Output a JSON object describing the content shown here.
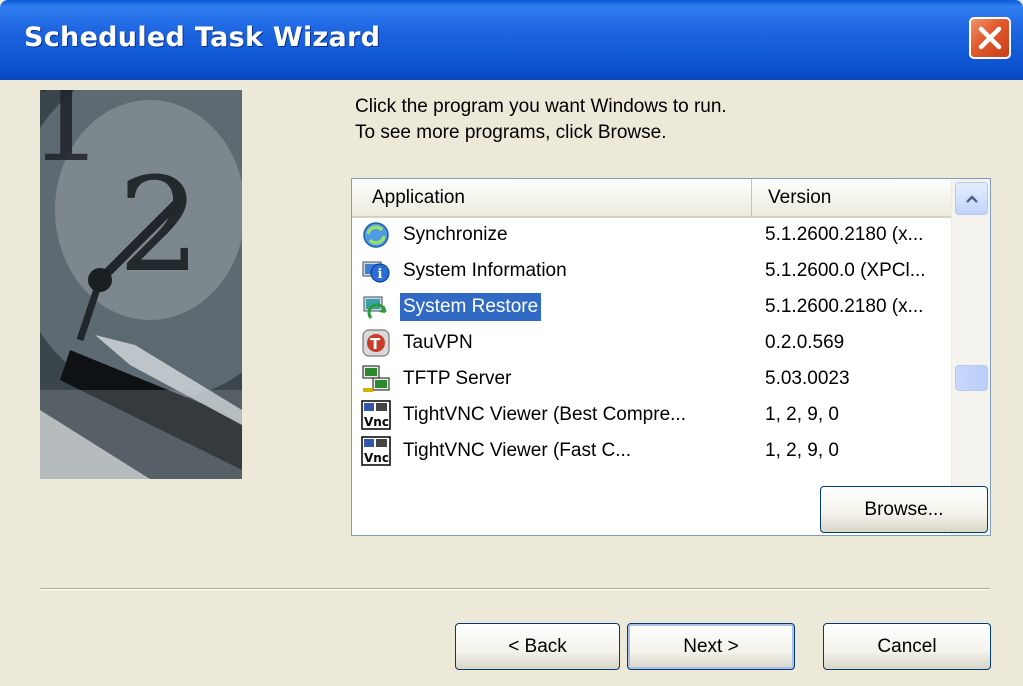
{
  "window": {
    "title": "Scheduled Task Wizard"
  },
  "instructions": {
    "line1": "Click the program you want Windows to run.",
    "line2": "To see more programs, click Browse."
  },
  "list": {
    "headers": {
      "application": "Application",
      "version": "Version"
    },
    "rows": [
      {
        "name": "Synchronize",
        "version": "5.1.2600.2180 (x...",
        "icon": "synchronize-icon"
      },
      {
        "name": "System Information",
        "version": "5.1.2600.0 (XPCl...",
        "icon": "system-information-icon"
      },
      {
        "name": "System Restore",
        "version": "5.1.2600.2180 (x...",
        "icon": "system-restore-icon",
        "selected": true
      },
      {
        "name": "TauVPN",
        "version": "0.2.0.569",
        "icon": "tauvpn-icon"
      },
      {
        "name": "TFTP Server",
        "version": "5.03.0023",
        "icon": "tftp-server-icon"
      },
      {
        "name": "TightVNC Viewer (Best Compre...",
        "version": "1, 2, 9, 0",
        "icon": "tightvnc-icon"
      },
      {
        "name": "TightVNC Viewer (Fast C...",
        "version": "1, 2, 9, 0",
        "icon": "tightvnc-icon"
      }
    ]
  },
  "buttons": {
    "browse": "Browse...",
    "back": "< Back",
    "next": "Next >",
    "cancel": "Cancel"
  },
  "colors": {
    "titlebar": "#0a5bd8",
    "selection": "#316ac5",
    "dialog_bg": "#ece9d8",
    "close_button": "#e1582c"
  }
}
